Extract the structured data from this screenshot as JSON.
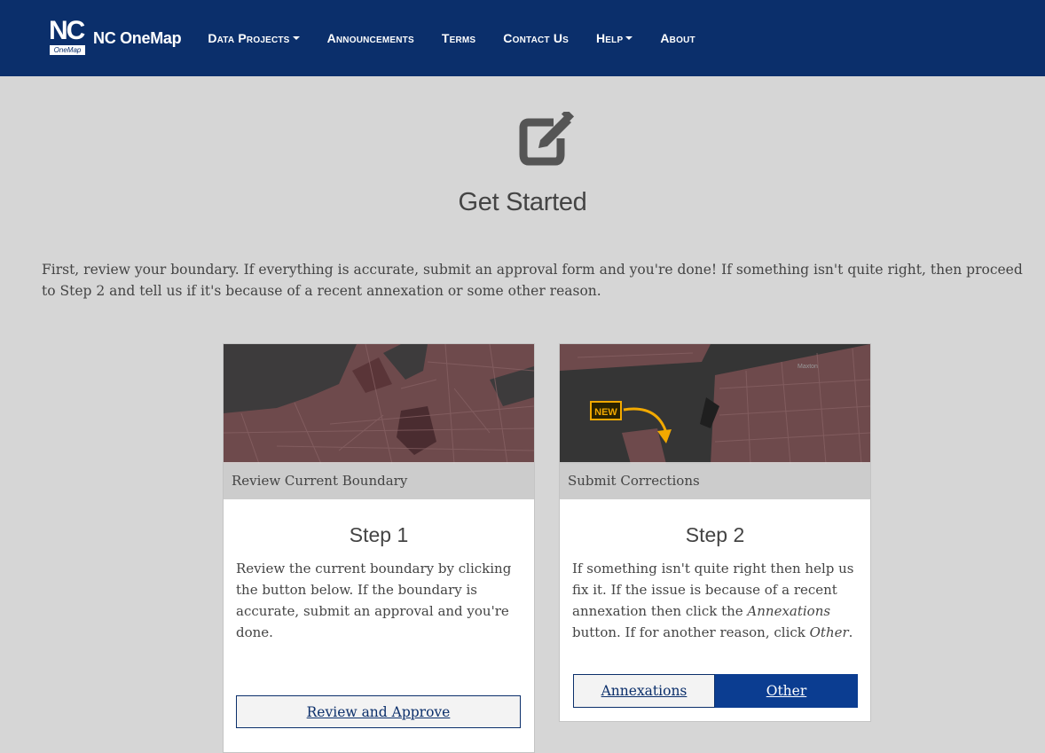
{
  "navbar": {
    "logo_nc": "NC",
    "logo_onemap": "OneMap",
    "brand": "NC OneMap",
    "items": [
      {
        "label": "Data Projects",
        "dropdown": true
      },
      {
        "label": "Announcements",
        "dropdown": false
      },
      {
        "label": "Terms",
        "dropdown": false
      },
      {
        "label": "Contact Us",
        "dropdown": false
      },
      {
        "label": "Help",
        "dropdown": true
      },
      {
        "label": "About",
        "dropdown": false
      }
    ]
  },
  "hero": {
    "icon": "edit-square-icon",
    "title": "Get Started"
  },
  "intro": "First, review your boundary. If everything is accurate, submit an approval form and you're done! If something isn't quite right, then proceed to Step 2 and tell us if it's because of a recent annexation or some other reason.",
  "cards": [
    {
      "caption": "Review Current Boundary",
      "step": "Step 1",
      "text": "Review the current boundary by clicking the button below. If the boundary is accurate, submit an approval and you're done.",
      "button": "Review and Approve"
    },
    {
      "caption": "Submit Corrections",
      "step": "Step 2",
      "text_parts": [
        "If something isn't quite right then help us fix it. If the issue is because of a recent annexation then click the ",
        "Annexations",
        " button. If for another reason, click ",
        "Other",
        "."
      ],
      "map_badge": "NEW",
      "map_label": "Maxton",
      "buttons": [
        "Annexations",
        "Other"
      ]
    }
  ],
  "colors": {
    "navbar": "#0b2f6b",
    "page_bg": "#d6d6d6",
    "primary_button": "#0b3d91",
    "map_boundary": "#6e4a4c",
    "badge": "#f2a900"
  }
}
